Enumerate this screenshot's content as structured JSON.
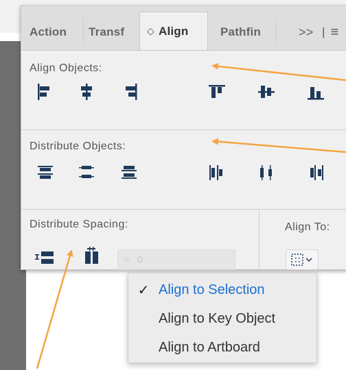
{
  "tabs": [
    {
      "label": "Action"
    },
    {
      "label": "Transf"
    },
    {
      "label": "Align"
    },
    {
      "label": "Pathfin"
    }
  ],
  "tab_overflow": "»",
  "tab_menu_icon": "hamburger-icon",
  "sections": {
    "align_objects": "Align Objects:",
    "distribute_objects": "Distribute Objects:",
    "distribute_spacing": "Distribute Spacing:",
    "align_to": "Align To:"
  },
  "spacing_value": "0",
  "dropdown": {
    "items": [
      {
        "label": "Align to Selection",
        "selected": true
      },
      {
        "label": "Align to Key Object",
        "selected": false
      },
      {
        "label": "Align to Artboard",
        "selected": false
      }
    ]
  },
  "colors": {
    "accent": "#1a6fd1",
    "annotation_arrow": "#f5a442",
    "icon": "#1f3a5a"
  }
}
